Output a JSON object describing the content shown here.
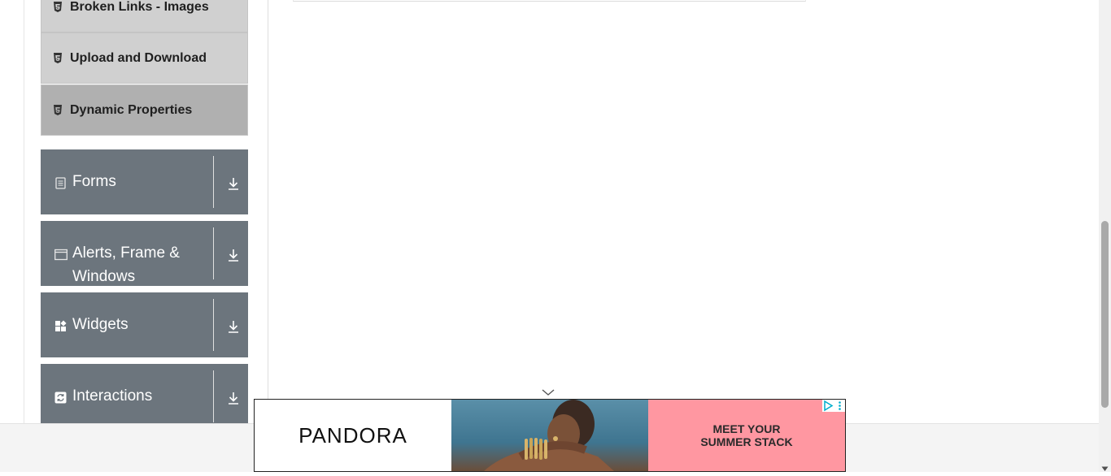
{
  "sidebar": {
    "sub_items": [
      {
        "label": "Broken Links - Images",
        "icon": "html5-icon"
      },
      {
        "label": "Upload and Download",
        "icon": "html5-icon"
      },
      {
        "label": "Dynamic Properties",
        "icon": "html5-icon",
        "active": true
      }
    ],
    "groups": [
      {
        "label": "Forms",
        "icon": "document-icon",
        "toggle_icon": "download-arrow-icon"
      },
      {
        "label": "Alerts, Frame & Windows",
        "icon": "window-icon",
        "toggle_icon": "download-arrow-icon"
      },
      {
        "label": "Widgets",
        "icon": "widgets-icon",
        "toggle_icon": "download-arrow-icon"
      },
      {
        "label": "Interactions",
        "icon": "refresh-icon",
        "toggle_icon": "download-arrow-icon"
      }
    ]
  },
  "ad": {
    "brand": "PANDORA",
    "cta": "MEET YOUR\nSUMMER STACK",
    "colors": {
      "cta_bg": "#ff97a1"
    }
  },
  "colors": {
    "group_bg": "#6c757d",
    "subitem_bg": "#d0d0d0",
    "subitem_active_bg": "#b0b0b0"
  }
}
